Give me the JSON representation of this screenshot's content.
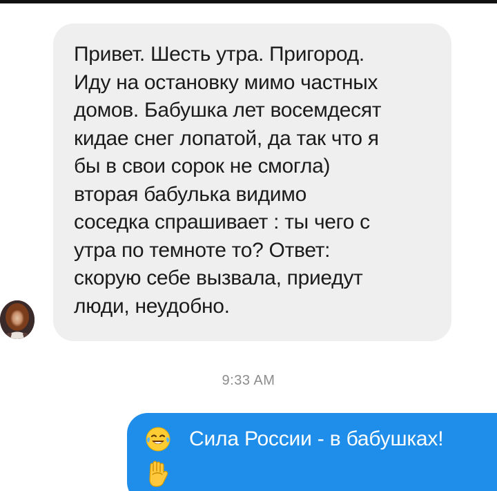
{
  "messages": {
    "incoming": {
      "text": "Привет. Шесть утра. Пригород.\nИду на остановку мимо частных\nдомов. Бабушка лет восемдесят\nкидае снег лопатой, да так что я\nбы в свои сорок не смогла)\nвторая бабулька видимо\nсоседка спрашивает : ты чего с\nутра по темноте то? Ответ:\nскорую себе вызвала, приедут\nлюди, неудобно.",
      "avatar_icon": "user-avatar"
    },
    "timestamp": "9:33 AM",
    "outgoing": {
      "text": "Сила России - в бабушках!",
      "emoji_laugh": "face-with-tears-of-joy-icon",
      "emoji_fist": "raised-fist-icon"
    }
  },
  "colors": {
    "incoming_bubble": "#efefef",
    "outgoing_bubble": "#1f8eea",
    "timestamp": "#8c8c8c",
    "text_dark": "#1b1b1b",
    "text_light": "#ffffff"
  }
}
